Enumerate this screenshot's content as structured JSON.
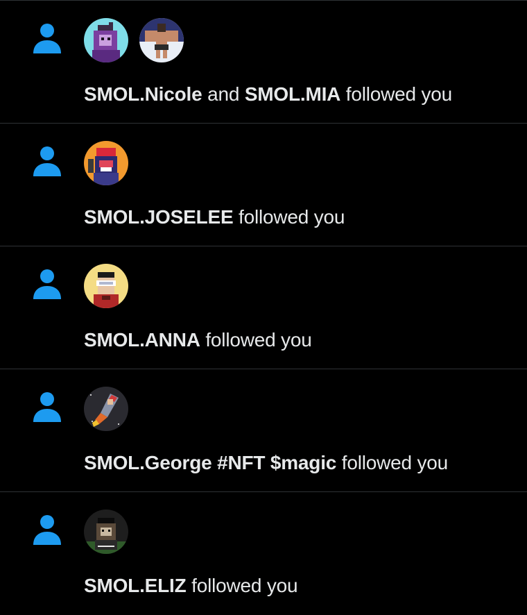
{
  "colors": {
    "background": "#000000",
    "divider": "#2f3336",
    "icon_blue": "#1d9bf0",
    "text": "#e7e9ea"
  },
  "icons": {
    "notification_type": "person-icon"
  },
  "notifications": [
    {
      "user1": "SMOL.Nicole",
      "connector": "and",
      "user2": "SMOL.MIA",
      "action": "followed you",
      "avatars": [
        "purple-ape-avatar",
        "muscle-man-avatar"
      ]
    },
    {
      "user1": "SMOL.JOSELEE",
      "action": "followed you",
      "avatars": [
        "red-ape-avatar"
      ]
    },
    {
      "user1": "SMOL.ANNA",
      "action": "followed you",
      "avatars": [
        "vr-headset-avatar"
      ]
    },
    {
      "user1": "SMOL.George #NFT $magic",
      "action": "followed you",
      "avatars": [
        "rocket-avatar"
      ]
    },
    {
      "user1": "SMOL.ELIZ",
      "action": "followed you",
      "avatars": [
        "dark-ape-avatar"
      ]
    }
  ]
}
